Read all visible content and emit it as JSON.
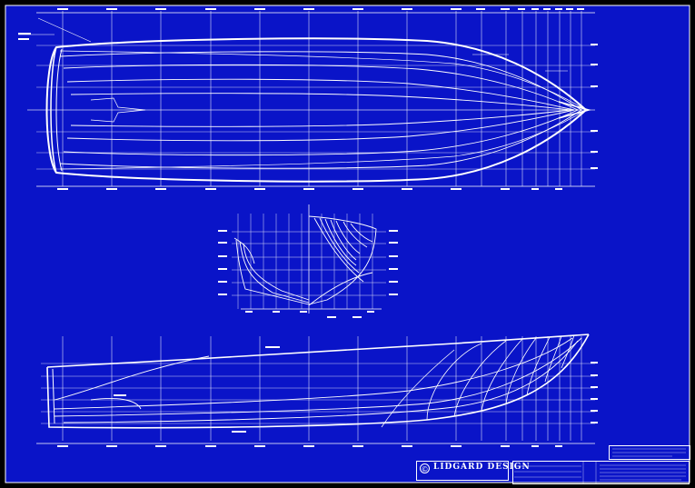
{
  "colors": {
    "paper": "#0a14c8",
    "ink": "#ffffff",
    "frame": "#000000"
  },
  "title_block": {
    "logo_glyph": "©",
    "firm": "LIDGARD DESIGN"
  }
}
